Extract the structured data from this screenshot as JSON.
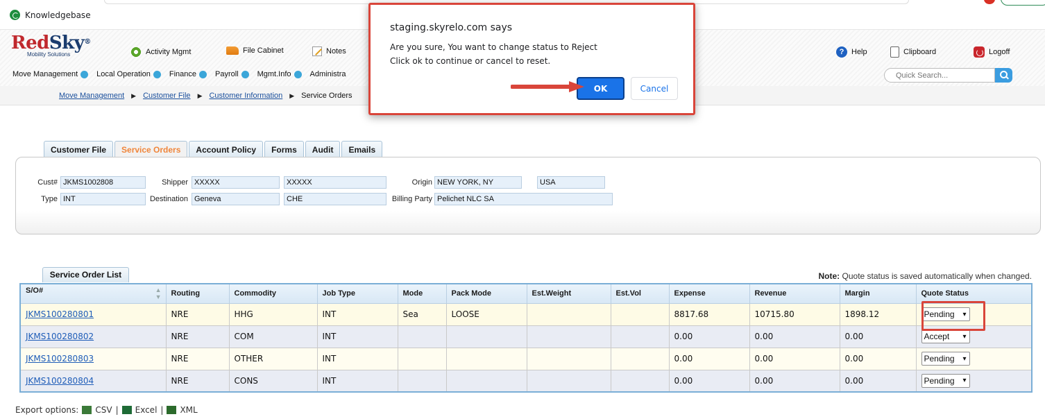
{
  "bookmarks": {
    "item": "Knowledgebase"
  },
  "brand": {
    "name_red": "Red",
    "name_blue": "Sky",
    "tagline": "Mobility Solutions"
  },
  "top_nav": {
    "activity": "Activity Mgmt",
    "file_cabinet": "File Cabinet",
    "notes": "Notes",
    "help": "Help",
    "clipboard": "Clipboard",
    "logoff": "Logoff"
  },
  "main_nav": [
    "Move Management",
    "Local Operation",
    "Finance",
    "Payroll",
    "Mgmt.Info",
    "Administra"
  ],
  "search": {
    "placeholder": "Quick Search..."
  },
  "breadcrumb": [
    "Move Management",
    "Customer File",
    "Customer Information",
    "Service Orders"
  ],
  "tabs": [
    "Customer File",
    "Service Orders",
    "Account Policy",
    "Forms",
    "Audit",
    "Emails"
  ],
  "customer": {
    "cust_label": "Cust#",
    "cust_value": "JKMS1002808",
    "shipper_label": "Shipper",
    "shipper_first": "XXXXX",
    "shipper_last": "XXXXX",
    "origin_label": "Origin",
    "origin_city": "NEW YORK, NY",
    "origin_country": "USA",
    "type_label": "Type",
    "type_value": "INT",
    "destination_label": "Destination",
    "destination_city": "Geneva",
    "destination_country": "CHE",
    "billing_label": "Billing Party",
    "billing_value": "Pelichet NLC SA"
  },
  "service_orders": {
    "tab_label": "Service Order List",
    "note_bold": "Note:",
    "note_text": " Quote status is saved automatically when changed.",
    "columns": [
      "S/O#",
      "Routing",
      "Commodity",
      "Job Type",
      "Mode",
      "Pack Mode",
      "Est.Weight",
      "Est.Vol",
      "Expense",
      "Revenue",
      "Margin",
      "Quote Status"
    ],
    "rows": [
      {
        "so": "JKMS100280801",
        "routing": "NRE",
        "commodity": "HHG",
        "job_type": "INT",
        "mode": "Sea",
        "pack_mode": "LOOSE",
        "est_weight": "",
        "est_vol": "",
        "expense": "8817.68",
        "revenue": "10715.80",
        "margin": "1898.12",
        "quote_status": "Pending"
      },
      {
        "so": "JKMS100280802",
        "routing": "NRE",
        "commodity": "COM",
        "job_type": "INT",
        "mode": "",
        "pack_mode": "",
        "est_weight": "",
        "est_vol": "",
        "expense": "0.00",
        "revenue": "0.00",
        "margin": "0.00",
        "quote_status": "Accept"
      },
      {
        "so": "JKMS100280803",
        "routing": "NRE",
        "commodity": "OTHER",
        "job_type": "INT",
        "mode": "",
        "pack_mode": "",
        "est_weight": "",
        "est_vol": "",
        "expense": "0.00",
        "revenue": "0.00",
        "margin": "0.00",
        "quote_status": "Pending"
      },
      {
        "so": "JKMS100280804",
        "routing": "NRE",
        "commodity": "CONS",
        "job_type": "INT",
        "mode": "",
        "pack_mode": "",
        "est_weight": "",
        "est_vol": "",
        "expense": "0.00",
        "revenue": "0.00",
        "margin": "0.00",
        "quote_status": "Pending"
      }
    ]
  },
  "export": {
    "label": "Export options:",
    "csv": "CSV",
    "excel": "Excel",
    "xml": "XML",
    "sep": "|"
  },
  "dialog": {
    "title": "staging.skyrelo.com says",
    "message_line1": "Are you sure, You want to change status to Reject",
    "message_line2": "Click ok to continue or cancel to reset.",
    "ok": "OK",
    "cancel": "Cancel"
  },
  "colors": {
    "highlight": "#d9453a",
    "accent_blue": "#1a73e8",
    "tab_active": "#f0853a",
    "brand_red": "#c0282d",
    "brand_blue": "#1b3c6e"
  }
}
